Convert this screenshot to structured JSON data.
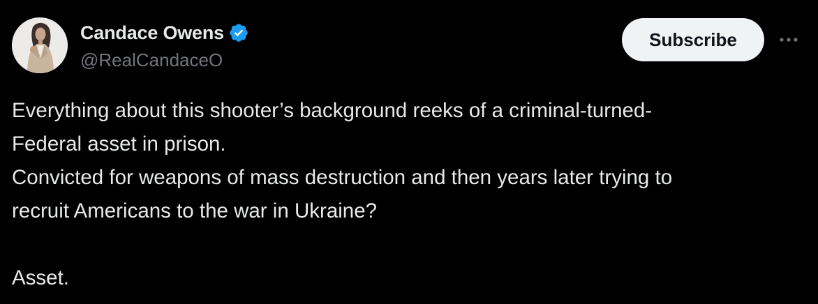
{
  "author": {
    "display_name": "Candace Owens",
    "handle": "@RealCandaceO",
    "verified": true,
    "verified_icon": "verified-badge-icon"
  },
  "actions": {
    "subscribe_label": "Subscribe",
    "more_icon": "more-options-icon"
  },
  "tweet": {
    "lines": [
      "Everything about this shooter’s background reeks of a criminal-turned-",
      "Federal asset in prison.",
      "Convicted for weapons of mass destruction and then years later trying to",
      "recruit Americans to the war in Ukraine?",
      "",
      "Asset."
    ]
  },
  "colors": {
    "background": "#000000",
    "text_primary": "#e7e9ea",
    "text_secondary": "#71767b",
    "verified_blue": "#1d9bf0",
    "button_bg": "#eff3f4",
    "button_text": "#0f1419"
  }
}
